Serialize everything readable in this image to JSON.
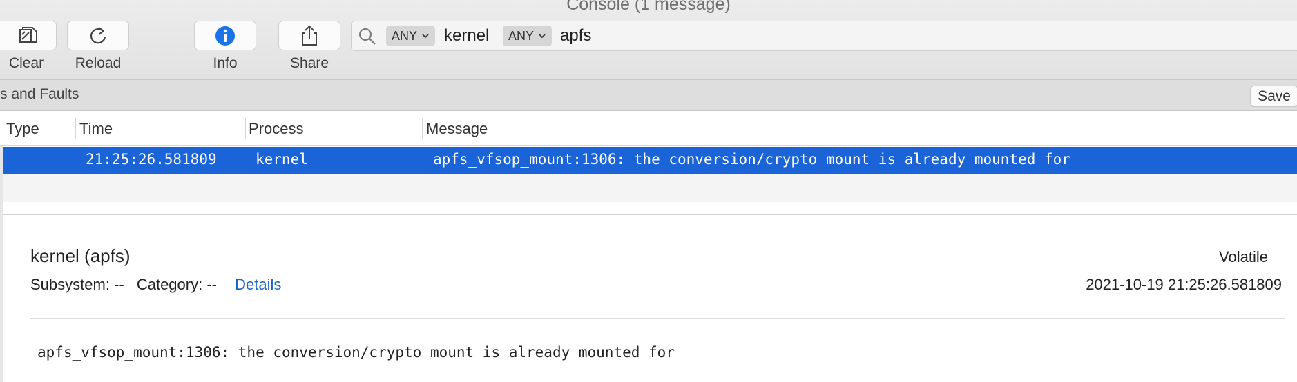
{
  "window": {
    "title": "Console (1 message)"
  },
  "toolbar": {
    "clear_label": "Clear",
    "reload_label": "Reload",
    "info_label": "Info",
    "share_label": "Share",
    "accent_color": "#1a73e8"
  },
  "search": {
    "tokens": [
      {
        "scope": "ANY",
        "value": "kernel"
      },
      {
        "scope": "ANY",
        "value": "apfs"
      }
    ]
  },
  "filter_bar": {
    "label": "s and Faults",
    "save_label": "Save"
  },
  "table": {
    "columns": [
      "Type",
      "Time",
      "Process",
      "Message"
    ],
    "rows": [
      {
        "type": "",
        "time": "21:25:26.581809",
        "process": "kernel",
        "message": "apfs_vfsop_mount:1306: the conversion/crypto mount is already mounted for",
        "selected": true
      }
    ],
    "selection_color": "#1a64d8"
  },
  "detail": {
    "title": "kernel (apfs)",
    "volatile": "Volatile",
    "subsystem": "Subsystem: --",
    "category": "Category: --",
    "details_link": "Details",
    "timestamp": "2021-10-19 21:25:26.581809",
    "message": "apfs_vfsop_mount:1306: the conversion/crypto mount is already mounted for"
  }
}
